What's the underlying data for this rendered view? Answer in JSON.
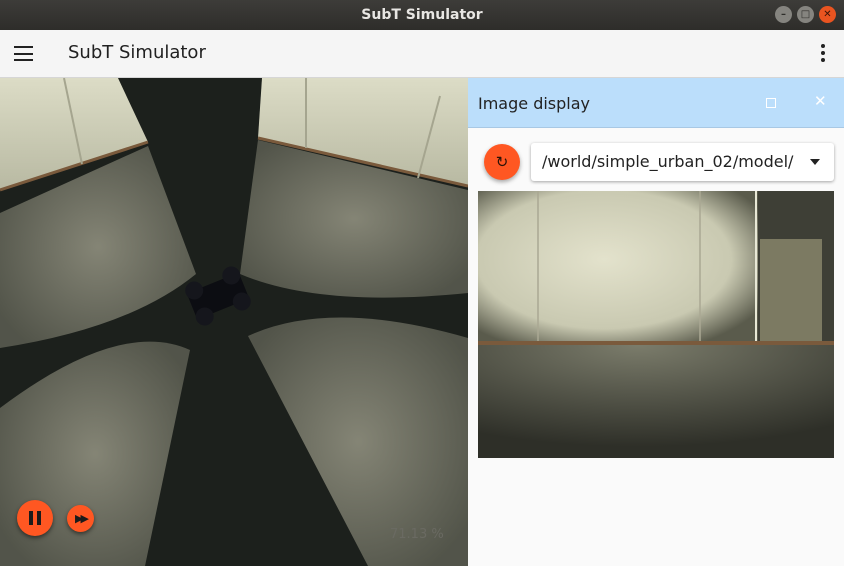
{
  "window": {
    "title": "SubT Simulator",
    "controls": [
      "minimize",
      "maximize",
      "close"
    ]
  },
  "appbar": {
    "title": "SubT Simulator",
    "menu_icon": "hamburger-menu-icon",
    "overflow_icon": "more-vert-icon"
  },
  "scene": {
    "controls": {
      "play_icon": "pause-icon",
      "step_icon": "fast-forward-icon"
    },
    "real_time_factor": "71.13 %"
  },
  "image_display": {
    "title": "Image display",
    "refresh_icon": "refresh-icon",
    "topic": "/world/simple_urban_02/model/"
  },
  "colors": {
    "accent": "#ff5722",
    "panel_header": "#bbdefb",
    "titlebar": "#2e2d2a"
  }
}
